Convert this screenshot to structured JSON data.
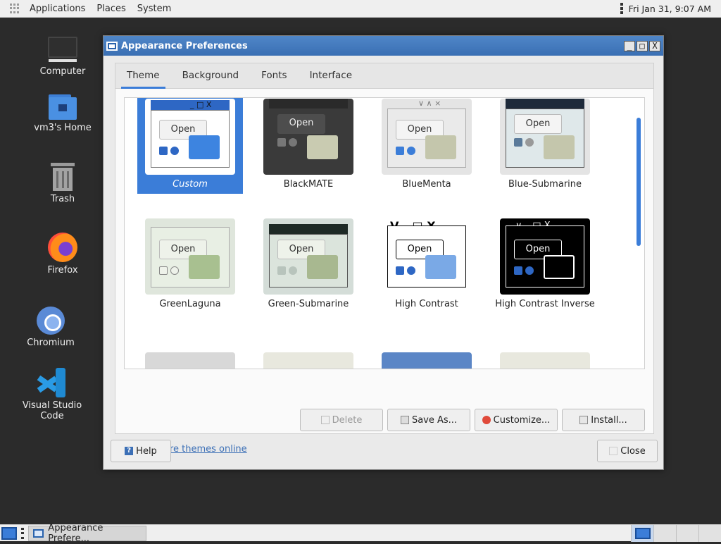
{
  "top_panel": {
    "menus": [
      "Applications",
      "Places",
      "System"
    ],
    "clock": "Fri Jan 31,  9:07 AM"
  },
  "desktop": {
    "icons": [
      {
        "label": "Computer",
        "icon": "computer-icon"
      },
      {
        "label": "vm3's Home",
        "icon": "home-folder-icon"
      },
      {
        "label": "Trash",
        "icon": "trash-icon"
      },
      {
        "label": "Firefox",
        "icon": "firefox-icon"
      },
      {
        "label": "Chromium",
        "icon": "chromium-icon"
      },
      {
        "label": "Visual Studio Code",
        "icon": "vscode-icon"
      }
    ]
  },
  "dialog": {
    "title": "Appearance Preferences",
    "wm_buttons": [
      "_",
      "□",
      "X"
    ],
    "tabs": [
      {
        "label": "Theme",
        "active": true
      },
      {
        "label": "Background",
        "active": false
      },
      {
        "label": "Fonts",
        "active": false
      },
      {
        "label": "Interface",
        "active": false
      }
    ],
    "themes": [
      {
        "name": "Custom",
        "selected": true,
        "open_label": "Open"
      },
      {
        "name": "BlackMATE",
        "selected": false,
        "open_label": "Open"
      },
      {
        "name": "BlueMenta",
        "selected": false,
        "open_label": "Open"
      },
      {
        "name": "Blue-Submarine",
        "selected": false,
        "open_label": "Open"
      },
      {
        "name": "GreenLaguna",
        "selected": false,
        "open_label": "Open"
      },
      {
        "name": "Green-Submarine",
        "selected": false,
        "open_label": "Open"
      },
      {
        "name": "High Contrast",
        "selected": false,
        "open_label": "Open"
      },
      {
        "name": "High Contrast Inverse",
        "selected": false,
        "open_label": "Open"
      }
    ],
    "actions": {
      "delete": "Delete",
      "save_as": "Save As...",
      "customize": "Customize...",
      "install": "Install..."
    },
    "more_themes_link": "Get more themes online",
    "help": "Help",
    "close": "Close"
  },
  "taskbar": {
    "task_label": "Appearance Prefere..."
  },
  "colors": {
    "accent": "#3b7dd8",
    "titlebar": "#3a6fb3",
    "link": "#3b6fb6"
  }
}
